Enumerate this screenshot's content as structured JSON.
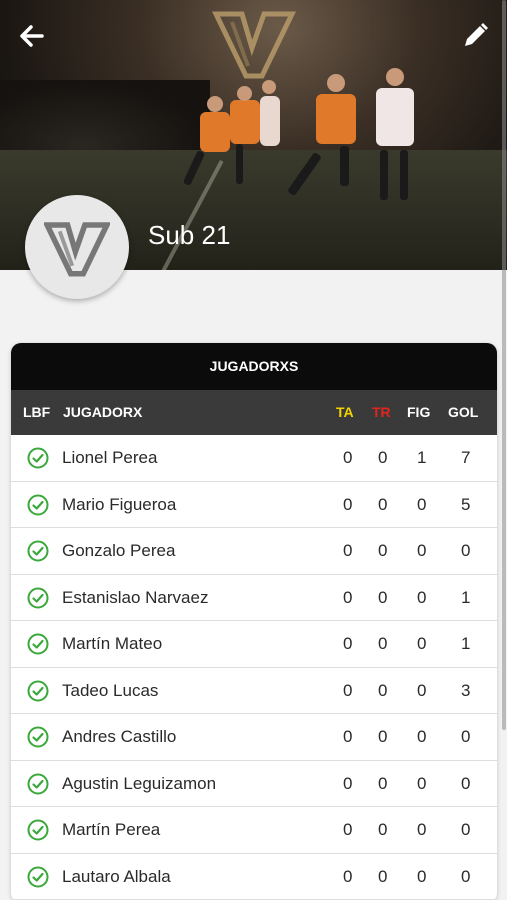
{
  "header": {
    "back_icon": "arrow-left-icon",
    "edit_icon": "pencil-icon",
    "logo_icon": "club-logo-icon"
  },
  "team": {
    "name": "Sub 21"
  },
  "players_table": {
    "title": "JUGADORXS",
    "columns": {
      "lbf": "LBF",
      "name": "JUGADORX",
      "ta": "TA",
      "tr": "TR",
      "fig": "FIG",
      "gol": "GOL"
    },
    "colors": {
      "ta": "#f4d400",
      "tr": "#e0241e",
      "check": "#3aa83a"
    },
    "rows": [
      {
        "name": "Lionel Perea",
        "ta": "0",
        "tr": "0",
        "fig": "1",
        "gol": "7"
      },
      {
        "name": "Mario Figueroa",
        "ta": "0",
        "tr": "0",
        "fig": "0",
        "gol": "5"
      },
      {
        "name": "Gonzalo Perea",
        "ta": "0",
        "tr": "0",
        "fig": "0",
        "gol": "0"
      },
      {
        "name": "Estanislao Narvaez",
        "ta": "0",
        "tr": "0",
        "fig": "0",
        "gol": "1"
      },
      {
        "name": "Martín Mateo",
        "ta": "0",
        "tr": "0",
        "fig": "0",
        "gol": "1"
      },
      {
        "name": "Tadeo Lucas",
        "ta": "0",
        "tr": "0",
        "fig": "0",
        "gol": "3"
      },
      {
        "name": "Andres Castillo",
        "ta": "0",
        "tr": "0",
        "fig": "0",
        "gol": "0"
      },
      {
        "name": "Agustin Leguizamon",
        "ta": "0",
        "tr": "0",
        "fig": "0",
        "gol": "0"
      },
      {
        "name": "Martín Perea",
        "ta": "0",
        "tr": "0",
        "fig": "0",
        "gol": "0"
      },
      {
        "name": "Lautaro Albala",
        "ta": "0",
        "tr": "0",
        "fig": "0",
        "gol": "0"
      }
    ]
  }
}
